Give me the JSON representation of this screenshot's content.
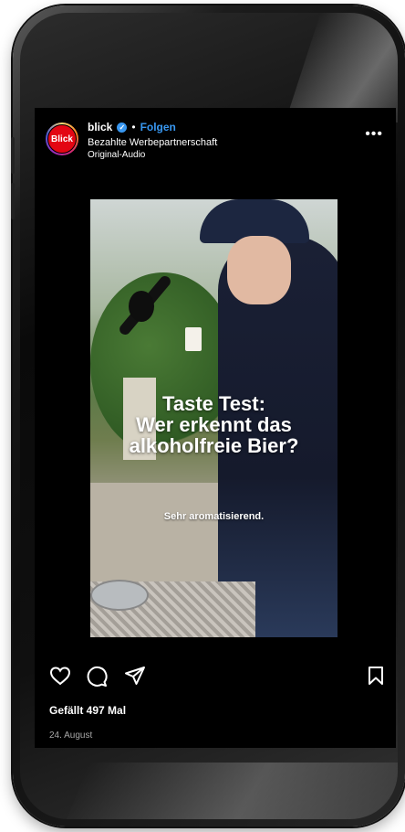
{
  "post": {
    "username": "blick",
    "verified_mark": "✓",
    "separator": "•",
    "follow_label": "Folgen",
    "sponsored_label": "Bezahlte Werbepartnerschaft",
    "audio_label": "Original-Audio",
    "avatar_text": "Blick",
    "more_label": "•••"
  },
  "video": {
    "title_lines": [
      "Taste Test:",
      "Wer erkennt das",
      "alkoholfreie Bier?"
    ],
    "subtitle": "Sehr aromatisierend."
  },
  "actions": {
    "icons": [
      "heart-icon",
      "comment-icon",
      "share-icon",
      "bookmark-icon"
    ]
  },
  "engagement": {
    "likes_text": "Gefällt 497 Mal",
    "date_text": "24. August"
  },
  "colors": {
    "follow": "#3897f0",
    "brand_red": "#e30613",
    "screen_bg": "#000000"
  }
}
